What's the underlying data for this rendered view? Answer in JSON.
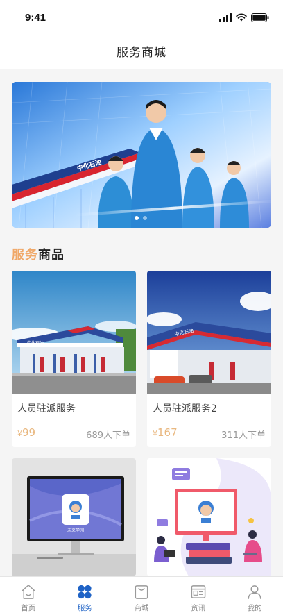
{
  "status_bar": {
    "time": "9:41",
    "icons": [
      "signal-icon",
      "wifi-icon",
      "battery-icon"
    ]
  },
  "header": {
    "title": "服务商城"
  },
  "banner": {
    "station_sign": "中化石油"
  },
  "section": {
    "title_part1": "服务",
    "title_part2": "商品"
  },
  "products": [
    {
      "name": "人员驻派服务",
      "currency": "¥",
      "price": "99",
      "sales": "689人下单",
      "sign_text": "中化石油"
    },
    {
      "name": "人员驻派服务2",
      "currency": "¥",
      "price": "167",
      "sales": "311人下单",
      "sign_text": "中化石油"
    },
    {
      "logo_text": "未来学园"
    },
    {}
  ],
  "tabs": [
    {
      "label": "首页",
      "icon": "home-icon",
      "active": false
    },
    {
      "label": "服务",
      "icon": "service-grid-icon",
      "active": true
    },
    {
      "label": "商城",
      "icon": "shopping-bag-icon",
      "active": false
    },
    {
      "label": "资讯",
      "icon": "news-icon",
      "active": false
    },
    {
      "label": "我的",
      "icon": "user-icon",
      "active": false
    }
  ],
  "colors": {
    "accent": "#1f63c6",
    "price": "#e9b880",
    "section_accent": "#f0a868"
  }
}
